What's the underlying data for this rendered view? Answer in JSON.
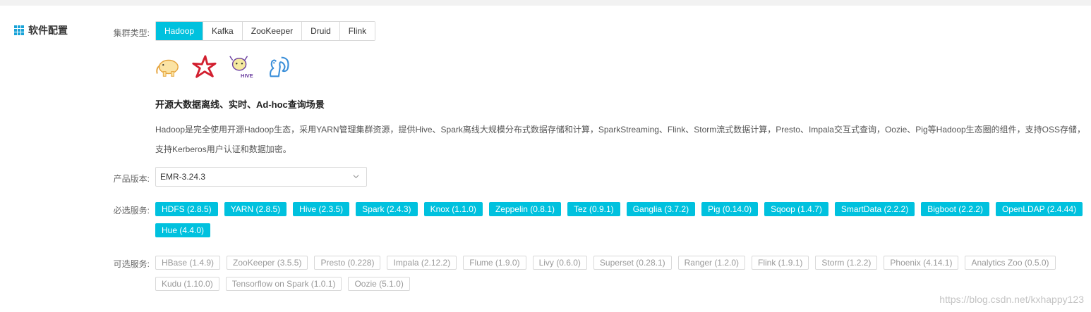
{
  "section": {
    "title": "软件配置",
    "icon": "grid-icon"
  },
  "cluster_type": {
    "label": "集群类型:",
    "tabs": [
      "Hadoop",
      "Kafka",
      "ZooKeeper",
      "Druid",
      "Flink"
    ],
    "selected": "Hadoop"
  },
  "logos": [
    "hadoop-elephant-icon",
    "spark-star-icon",
    "hive-bee-icon",
    "squirrel-icon"
  ],
  "scenario": {
    "headline": "开源大数据离线、实时、Ad-hoc查询场景",
    "description": "Hadoop是完全使用开源Hadoop生态，采用YARN管理集群资源，提供Hive、Spark离线大规模分布式数据存储和计算，SparkStreaming、Flink、Storm流式数据计算，Presto、Impala交互式查询，Oozie、Pig等Hadoop生态圈的组件，支持OSS存储，支持Kerberos用户认证和数据加密。"
  },
  "product_version": {
    "label": "产品版本:",
    "value": "EMR-3.24.3"
  },
  "required_services": {
    "label": "必选服务:",
    "row1": [
      "HDFS (2.8.5)",
      "YARN (2.8.5)",
      "Hive (2.3.5)",
      "Spark (2.4.3)",
      "Knox (1.1.0)",
      "Zeppelin (0.8.1)",
      "Tez (0.9.1)",
      "Ganglia (3.7.2)",
      "Pig (0.14.0)",
      "Sqoop (1.4.7)",
      "SmartData (2.2.2)",
      "Bigboot (2.2.2)",
      "OpenLDAP (2.4.44)"
    ],
    "row2": [
      "Hue (4.4.0)"
    ]
  },
  "optional_services": {
    "label": "可选服务:",
    "row1": [
      "HBase (1.4.9)",
      "ZooKeeper (3.5.5)",
      "Presto (0.228)",
      "Impala (2.12.2)",
      "Flume (1.9.0)",
      "Livy (0.6.0)",
      "Superset (0.28.1)",
      "Ranger (1.2.0)",
      "Flink (1.9.1)",
      "Storm (1.2.2)",
      "Phoenix (4.14.1)",
      "Analytics Zoo (0.5.0)"
    ],
    "row2": [
      "Kudu (1.10.0)",
      "Tensorflow on Spark (1.0.1)",
      "Oozie (5.1.0)"
    ]
  },
  "watermark": "https://blog.csdn.net/kxhappy123",
  "colors": {
    "accent": "#00c1de",
    "icon_blue": "#1aa3d8"
  }
}
